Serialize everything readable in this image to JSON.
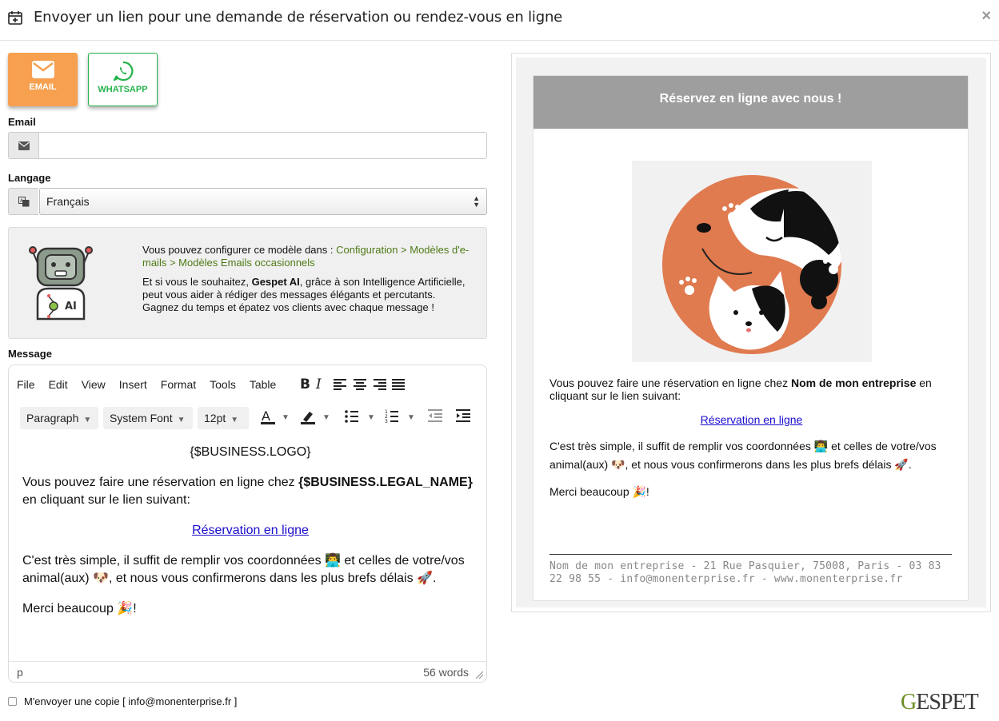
{
  "modal": {
    "title": "Envoyer un lien pour une demande de réservation ou rendez-vous en ligne",
    "close": "×"
  },
  "channels": {
    "email_label": "EMAIL",
    "whatsapp_label": "WHATSAPP",
    "email_color": "#f6a050",
    "whatsapp_color": "#25b34b"
  },
  "form": {
    "email_label": "Email",
    "email_value": "",
    "language_label": "Langage",
    "language_value": "Français"
  },
  "info": {
    "intro": "Vous pouvez configurer ce modèle dans : ",
    "config_link": "Configuration > Modèles d'e-mails > Modèles Emails occasionnels",
    "ai_prefix": "Et si vous le souhaitez, ",
    "ai_name": "Gespet AI",
    "ai_text": ", grâce à son Intelligence Artificielle, peut vous aider à rédiger des messages élégants et percutants.",
    "ai_tail": "Gagnez du temps et épatez vos clients avec chaque message !"
  },
  "editor": {
    "label": "Message",
    "menu": [
      "File",
      "Edit",
      "View",
      "Insert",
      "Format",
      "Tools",
      "Table"
    ],
    "block_format": "Paragraph",
    "font_family": "System Font",
    "font_size": "12pt",
    "logo_placeholder": "{$BUSINESS.LOGO}",
    "line1": "Vous pouvez faire une réservation en ligne chez ",
    "business_var": "{$BUSINESS.LEGAL_NAME}",
    "line1_tail": " en cliquant sur le lien suivant:",
    "link_text": "Réservation en ligne",
    "line2": "C'est très simple, il suffit de remplir vos coordonnées 👨‍💻 et celles de votre/vos animal(aux) 🐶, et nous vous confirmerons dans les plus brefs délais 🚀.",
    "line3": "Merci beaucoup 🎉!",
    "status_path": "p",
    "word_count": "56 words"
  },
  "copy": {
    "label": "M'envoyer une copie [ info@monenterprise.fr ]"
  },
  "preview": {
    "header": "Réservez en ligne avec nous !",
    "header_color": "#9e9e9e",
    "line1": "Vous pouvez faire une réservation en ligne chez ",
    "business_name": "Nom de mon entreprise",
    "line1_tail": " en cliquant sur le lien suivant:",
    "link_text": "Réservation en ligne",
    "line2": "C'est très simple, il suffit de remplir vos coordonnées 👨‍💻 et celles de votre/vos animal(aux) 🐶, et nous vous confirmerons dans les plus brefs délais 🚀.",
    "line3": "Merci beaucoup 🎉!",
    "footer": "Nom de mon entreprise - 21 Rue Pasquier, 75008, Paris - 03 83 22 98 55 - info@monenterprise.fr - www.monenterprise.fr"
  },
  "brand": {
    "first": "G",
    "rest": "ESPET"
  }
}
